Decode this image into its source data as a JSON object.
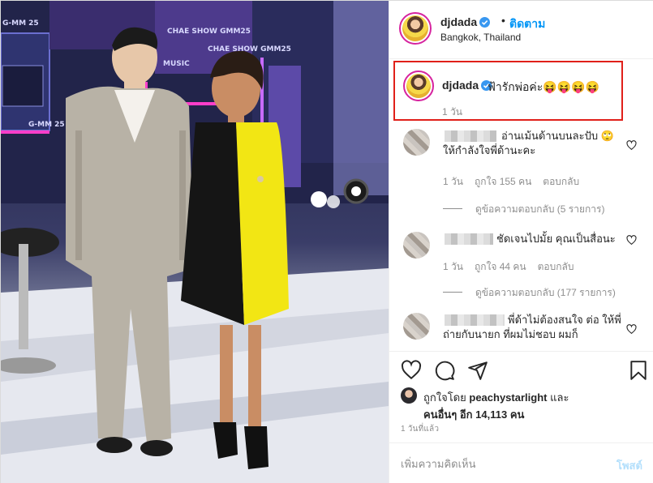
{
  "post": {
    "username": "djdada",
    "separator": "•",
    "follow_label": "ติดตาม",
    "location": "Bangkok, Thailand",
    "studio_signs": [
      "G-MM 25",
      "G-MM 25",
      "CHAE SHOW GMM25",
      "CHAE SHOW GMM25",
      "MUSIC"
    ]
  },
  "caption": {
    "username": "djdada",
    "text": "ฟ้ารักพ่อค่ะ😝😝😝😝",
    "time": "1 วัน"
  },
  "comments": [
    {
      "text": "อ่านเม้นด้านบนละปับ 🙄 ให้กำลังใจพี่ด้านะคะ",
      "time": "1 วัน",
      "likes": "ถูกใจ 155 คน",
      "reply_label": "ตอบกลับ",
      "view_replies": "ดูข้อความตอบกลับ (5 รายการ)"
    },
    {
      "text": "ชัดเจนไปมั้ย คุณเป็นสื่อนะ",
      "time": "1 วัน",
      "likes": "ถูกใจ 44 คน",
      "reply_label": "ตอบกลับ",
      "view_replies": "ดูข้อความตอบกลับ (177 รายการ)"
    },
    {
      "text": "พี่ด้าไม่ต้องสนใจ ต่อ ให้พี่ถ่ายกับนายก ที่ผมไม่ชอบ ผมก็",
      "time": "",
      "likes": "",
      "reply_label": "",
      "view_replies": ""
    }
  ],
  "actions": {
    "icons": [
      "heart-icon",
      "comment-icon",
      "share-icon",
      "bookmark-icon"
    ]
  },
  "likes": {
    "prefix": "ถูกใจโดย",
    "liker": "peachystarlight",
    "suffix": "และ",
    "others": "คนอื่นๆ อีก 14,113 คน"
  },
  "timestamp": "1 วันที่แล้ว",
  "add_comment": {
    "placeholder": "เพิ่มความคิดเห็น",
    "post_label": "โพสต์"
  },
  "colors": {
    "follow": "#0095f6",
    "highlight_border": "#e0201a",
    "verified": "#3897f0",
    "post_disabled": "#b2dffc"
  }
}
